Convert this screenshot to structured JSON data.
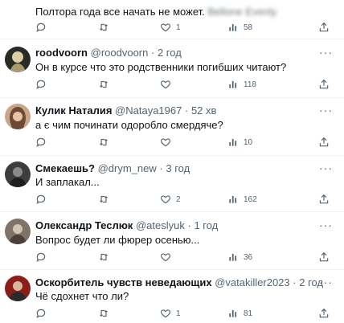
{
  "top": {
    "text": "Полтора года все начать не может.",
    "blurred_text": "Bellone Evenly",
    "likes": "1",
    "views": "58"
  },
  "tweets": [
    {
      "name": "roodvoorn",
      "handle": "@roodvoorn",
      "time": "2 год",
      "text": "Он в курсе что это родственники погибших читают?",
      "replies": "",
      "retweets": "",
      "likes": "",
      "views": "118"
    },
    {
      "name": "Кулик Наталия",
      "handle": "@Nataya1967",
      "time": "52 хв",
      "text": "а є чим починати одоробло смердяче?",
      "replies": "",
      "retweets": "",
      "likes": "",
      "views": "10"
    },
    {
      "name": "Смекаешь?",
      "handle": "@drym_new",
      "time": "3 год",
      "text": "И заплакал...",
      "replies": "",
      "retweets": "",
      "likes": "2",
      "views": "162"
    },
    {
      "name": "Олександр Теслюк",
      "handle": "@ateslyuk",
      "time": "1 год",
      "text": "Вопрос будет ли фюрер осенью...",
      "replies": "",
      "retweets": "",
      "likes": "",
      "views": "36"
    },
    {
      "name": "Оскорбитель чувств неведающих",
      "handle": "@vatakiller2023",
      "time": "2 год",
      "text": "Чё сдохнет что ли?",
      "replies": "",
      "retweets": "",
      "likes": "1",
      "views": "81"
    }
  ],
  "separator": "·",
  "more_label": "···",
  "colors": {
    "text": "#0f1419",
    "meta": "#536471",
    "divider": "#eff3f4"
  }
}
